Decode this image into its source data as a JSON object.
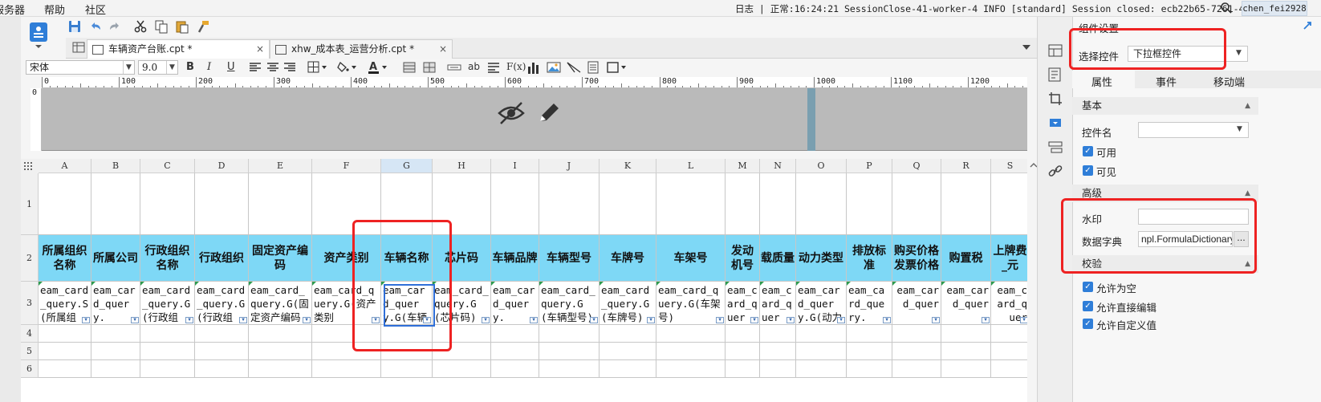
{
  "menubar": {
    "items": [
      "服务器",
      "帮助",
      "社区"
    ],
    "status_text": "日志 | 正常:16:24:21 SessionClose-41-worker-4 INFO [standard] Session closed: ecb22b65-7261-4ea8-...",
    "user": "chen_fei2928"
  },
  "tabs": [
    {
      "label": "车辆资产台账.cpt *",
      "close": "×"
    },
    {
      "label": "xhw_成本表_运营分析.cpt *",
      "close": "×"
    }
  ],
  "format_bar": {
    "font_name": "宋体",
    "font_size": "9.0",
    "bold": "B",
    "italic": "I",
    "underline": "U",
    "text_style_ab": "ab",
    "formula_btn": "F(x)"
  },
  "ruler": {
    "marks": [
      "0",
      "100",
      "200",
      "300",
      "400",
      "500",
      "600",
      "700",
      "800",
      "900",
      "1000",
      "1100",
      "1200"
    ],
    "v_mark": "0"
  },
  "grid": {
    "columns": [
      "A",
      "B",
      "C",
      "D",
      "E",
      "F",
      "G",
      "H",
      "I",
      "J",
      "K",
      "L",
      "M",
      "N",
      "O",
      "P",
      "Q",
      "R",
      "S"
    ],
    "selected_column": "G",
    "rows": [
      "1",
      "2",
      "3",
      "4",
      "5",
      "6"
    ],
    "headers": [
      "所属组织名称",
      "所属公司",
      "行政组织名称",
      "行政组织",
      "固定资产编码",
      "资产类别",
      "车辆名称",
      "芯片码",
      "车辆品牌",
      "车辆型号",
      "车牌号",
      "车架号",
      "发动机号",
      "载质量",
      "动力类型",
      "排放标准",
      "购买价格发票价格",
      "购置税",
      "上牌费_元"
    ],
    "row3": [
      "eam_card_query.S(所属组",
      "eam_card_query.",
      "eam_card_query.G(行政组",
      "eam_card_query.G(行政组",
      "eam_card_query.G(固定资产编码",
      "eam_card_query.G(资产类别",
      "eam_card_query.G(车辆名",
      "eam_card_query.G(芯片码)",
      "eam_card_query.",
      "eam_card_query.G(车辆型号)",
      "eam_card_query.G(车牌号)",
      "eam_card_query.G(车架号)",
      "eam_card_quer",
      "eam_card_quer",
      "eam_card_query.G(动力类",
      "eam_card_query.",
      "eam_card_quer",
      "eam_card_quer",
      "eam_card_quer"
    ]
  },
  "panel": {
    "title": "组件设置",
    "select_widget_label": "选择控件",
    "select_widget_value": "下拉框控件",
    "tabs": [
      "属性",
      "事件",
      "移动端"
    ],
    "basic_section": "基本",
    "widget_name_label": "控件名",
    "widget_name_value": "",
    "enabled_label": "可用",
    "visible_label": "可见",
    "advanced_section": "高级",
    "watermark_label": "水印",
    "watermark_value": "",
    "dict_label": "数据字典",
    "dict_value": "npl.FormulaDictionary",
    "dict_btn": "...",
    "validate_section": "校验",
    "allow_empty_label": "允许为空",
    "allow_edit_label": "允许直接编辑",
    "allow_custom_label": "允许自定义值"
  },
  "colors": {
    "header_fill": "#7ed8f6",
    "annotation_red": "#ee2222",
    "selection_blue": "#2f6fd8",
    "checkbox_blue": "#2f7ed8"
  }
}
